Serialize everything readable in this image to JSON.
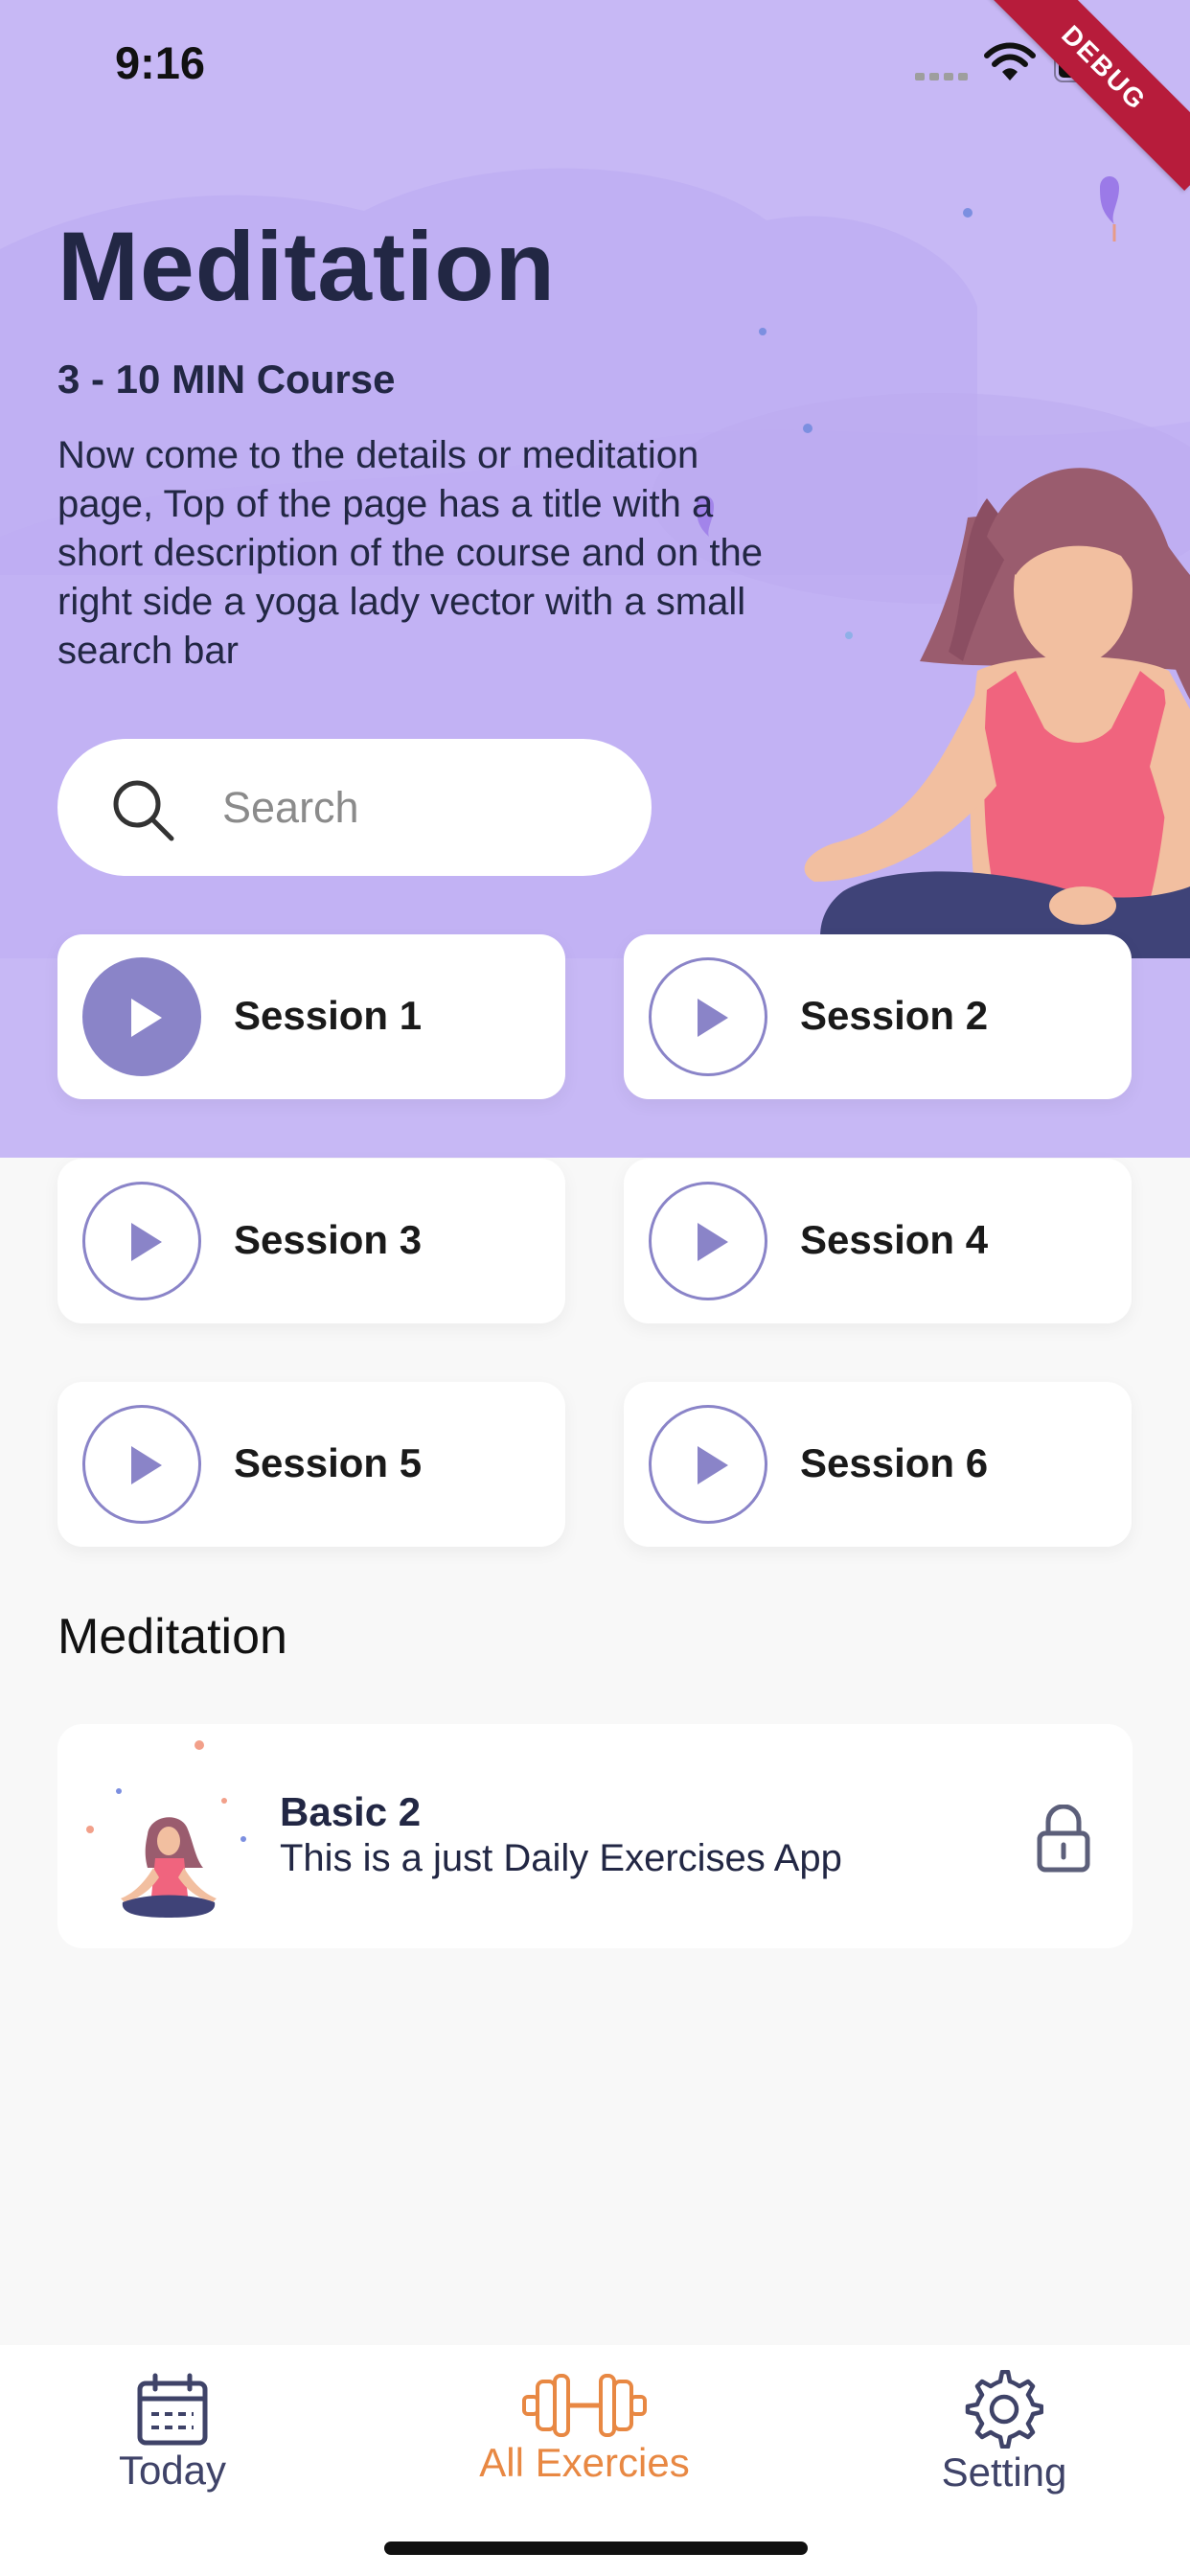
{
  "status_bar": {
    "time": "9:16",
    "debug_ribbon": "DEBUG"
  },
  "header": {
    "title": "Meditation",
    "course": "3 - 10 MIN Course",
    "description": "Now come to the details or meditation page, Top of the page has a title with a short description of the course and on the right side a yoga lady vector with a small search bar"
  },
  "search": {
    "placeholder": "Search"
  },
  "sessions": [
    {
      "label": "Session 1",
      "active": true
    },
    {
      "label": "Session 2",
      "active": false
    },
    {
      "label": "Session 3",
      "active": false
    },
    {
      "label": "Session 4",
      "active": false
    },
    {
      "label": "Session 5",
      "active": false
    },
    {
      "label": "Session 6",
      "active": false
    }
  ],
  "section": {
    "title": "Meditation"
  },
  "card": {
    "title": "Basic 2",
    "subtitle": "This is a just Daily Exercises App",
    "locked": true
  },
  "bottom_nav": {
    "items": [
      {
        "label": "Today",
        "icon": "calendar-icon",
        "active": false
      },
      {
        "label": "All Exercies",
        "icon": "dumbbell-icon",
        "active": true
      },
      {
        "label": "Setting",
        "icon": "gear-icon",
        "active": false
      }
    ]
  },
  "colors": {
    "hero_bg": "#C7B8F5",
    "accent": "#8A84C8",
    "nav_active": "#E88843",
    "text_dark": "#222744",
    "background": "#F8F8F8"
  }
}
